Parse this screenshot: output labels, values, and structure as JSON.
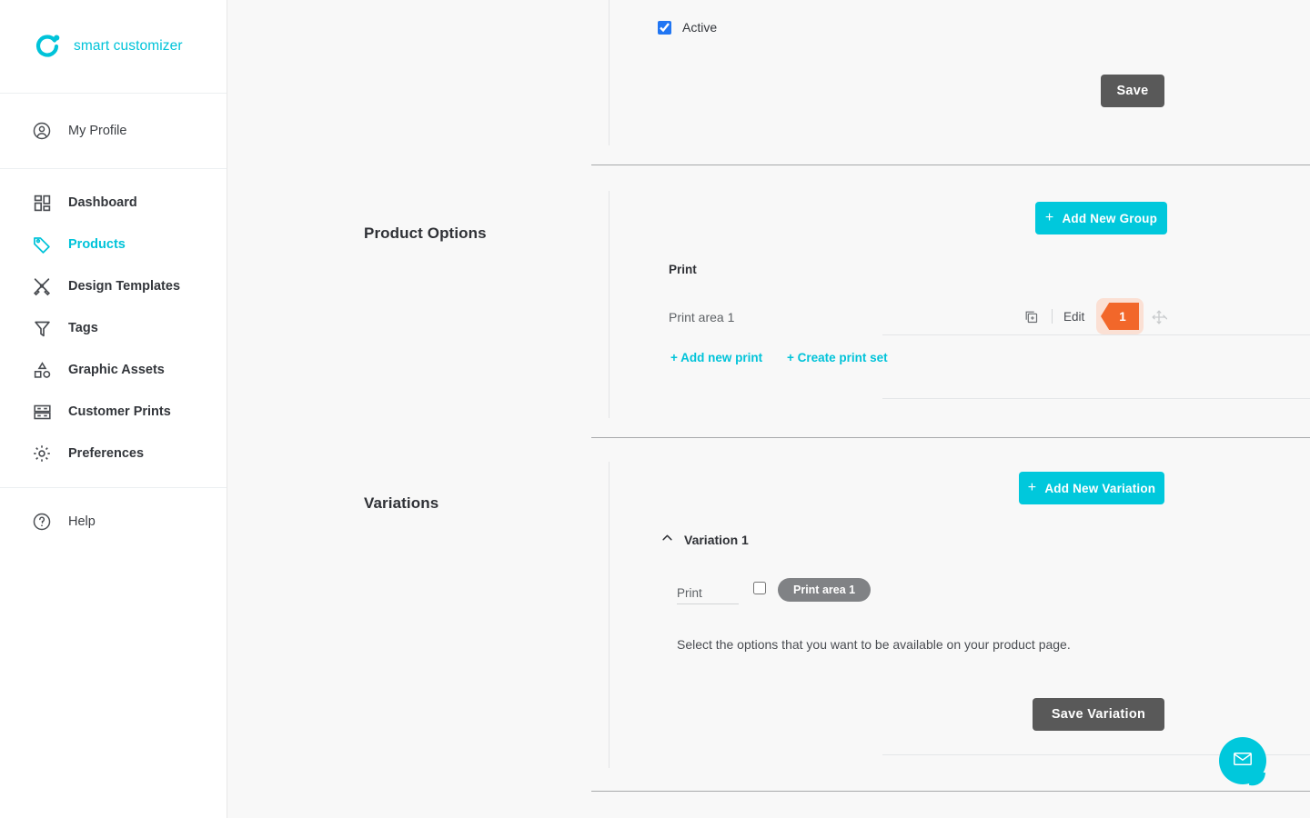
{
  "brand": {
    "name": "smart customizer",
    "logo_icon": "ring-dot-logo-icon",
    "accent_color": "#00c3d9"
  },
  "sidebar": {
    "profile": {
      "label": "My Profile",
      "icon": "user-circle-icon"
    },
    "items": [
      {
        "label": "Dashboard",
        "icon": "dashboard-grid-icon",
        "active": false
      },
      {
        "label": "Products",
        "icon": "tag-icon",
        "active": true
      },
      {
        "label": "Design Templates",
        "icon": "design-templates-icon",
        "active": false
      },
      {
        "label": "Tags",
        "icon": "funnel-icon",
        "active": false
      },
      {
        "label": "Graphic Assets",
        "icon": "shapes-icon",
        "active": false
      },
      {
        "label": "Customer Prints",
        "icon": "customer-prints-icon",
        "active": false
      },
      {
        "label": "Preferences",
        "icon": "gear-icon",
        "active": false
      }
    ],
    "help": {
      "label": "Help",
      "icon": "question-circle-icon"
    }
  },
  "top_section": {
    "active_checkbox": {
      "label": "Active",
      "checked": true
    },
    "save_button": "Save"
  },
  "product_options": {
    "title": "Product Options",
    "add_group_button": "Add New Group",
    "add_group_plus": "+",
    "group_name": "Print",
    "rows": [
      {
        "name": "Print area 1",
        "duplicate_icon": "duplicate-icon",
        "edit_label": "Edit",
        "badge_count": "1",
        "move_icon": "move-handle-icon"
      }
    ],
    "links": [
      {
        "label": "+ Add new print"
      },
      {
        "label": "+ Create print set"
      }
    ]
  },
  "variations": {
    "title": "Variations",
    "add_variation_button": "Add New Variation",
    "add_variation_plus": "+",
    "variation_1": {
      "label": "Variation 1",
      "collapse_icon": "chevron-up-icon",
      "option_name": "Print",
      "option_checked": false,
      "option_pill": "Print area 1",
      "hint": "Select the options that you want to be available on your product page.",
      "save_button": "Save Variation"
    }
  },
  "chat_widget": {
    "icon": "envelope-icon",
    "color": "#00c8dc"
  },
  "colors": {
    "accent_cyan": "#00c8dc",
    "badge_orange": "#f2672a",
    "badge_halo": "#fbe0d4",
    "dark_button": "#595959",
    "pill_gray": "#808285",
    "checkbox_blue": "#2176f3",
    "page_bg": "#f8f8f8"
  }
}
